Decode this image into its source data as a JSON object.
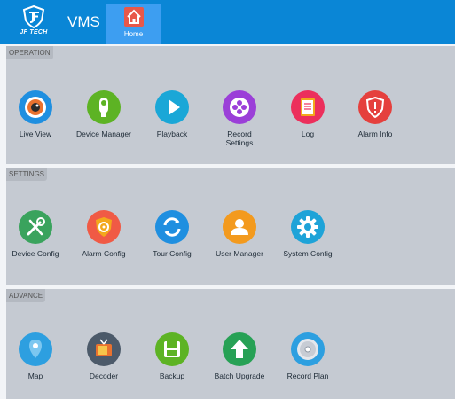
{
  "header": {
    "logo_text": "JF TECH",
    "app_title": "VMS",
    "home_tab_label": "Home"
  },
  "sections": {
    "operation": {
      "label": "OPERATION",
      "items": [
        {
          "label": "Live View",
          "icon": "live-view-icon",
          "color": "#1f8fe0"
        },
        {
          "label": "Device Manager",
          "icon": "device-manager-icon",
          "color": "#5db324"
        },
        {
          "label": "Playback",
          "icon": "playback-icon",
          "color": "#1aa7d7"
        },
        {
          "label": "Record Settings",
          "icon": "record-settings-icon",
          "color": "#9b3fd8"
        },
        {
          "label": "Log",
          "icon": "log-icon",
          "color": "#ec2f5c"
        },
        {
          "label": "Alarm Info",
          "icon": "alarm-info-icon",
          "color": "#e5403d"
        }
      ]
    },
    "settings": {
      "label": "SETTINGS",
      "items": [
        {
          "label": "Device Config",
          "icon": "device-config-icon",
          "color": "#3aa35d"
        },
        {
          "label": "Alarm Config",
          "icon": "alarm-config-icon",
          "color": "#f05a45"
        },
        {
          "label": "Tour Config",
          "icon": "tour-config-icon",
          "color": "#1f8fe0"
        },
        {
          "label": "User Manager",
          "icon": "user-manager-icon",
          "color": "#f39a1e"
        },
        {
          "label": "System Config",
          "icon": "system-config-icon",
          "color": "#1ea3d8"
        }
      ]
    },
    "advance": {
      "label": "ADVANCE",
      "items": [
        {
          "label": "Map",
          "icon": "map-icon",
          "color": "#2d9fe0"
        },
        {
          "label": "Decoder",
          "icon": "decoder-icon",
          "color": "#4c5a6a"
        },
        {
          "label": "Backup",
          "icon": "backup-icon",
          "color": "#5db324"
        },
        {
          "label": "Batch Upgrade",
          "icon": "batch-upgrade-icon",
          "color": "#27a155"
        },
        {
          "label": "Record Plan",
          "icon": "record-plan-icon",
          "color": "#2d9fe0"
        }
      ]
    }
  }
}
